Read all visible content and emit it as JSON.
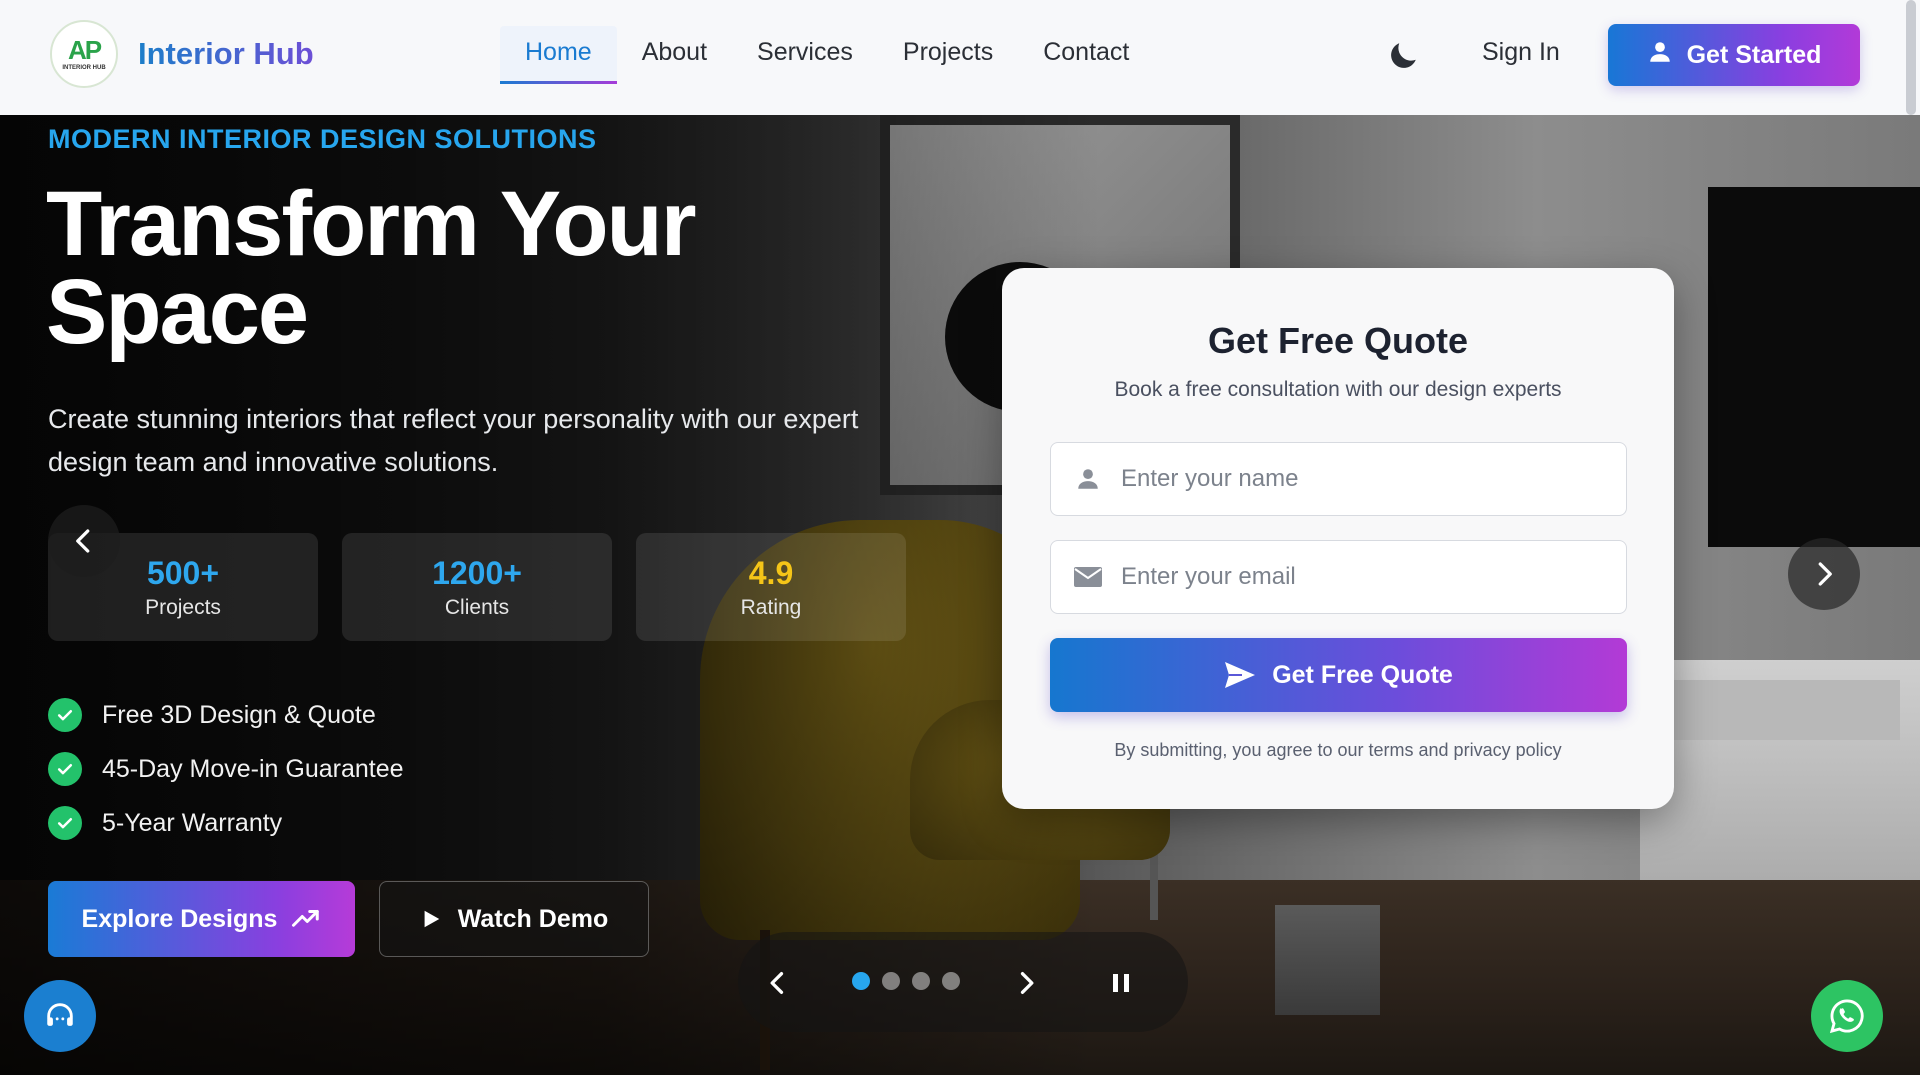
{
  "brand": {
    "name": "Interior Hub",
    "logo_text": "AP",
    "logo_caption": "INTERIOR HUB"
  },
  "nav": {
    "items": [
      {
        "label": "Home",
        "active": true
      },
      {
        "label": "About",
        "active": false
      },
      {
        "label": "Services",
        "active": false
      },
      {
        "label": "Projects",
        "active": false
      },
      {
        "label": "Contact",
        "active": false
      }
    ],
    "theme_icon": "moon-icon",
    "sign_in": "Sign In",
    "get_started": "Get Started"
  },
  "hero": {
    "eyebrow": "MODERN INTERIOR DESIGN SOLUTIONS",
    "headline_line1": "Transform Your",
    "headline_line2": "Space",
    "subtext": "Create stunning interiors that reflect your personality with our expert design team and innovative solutions.",
    "stats": [
      {
        "value": "500+",
        "label": "Projects",
        "color": "#2ea7ee"
      },
      {
        "value": "1200+",
        "label": "Clients",
        "color": "#2ea7ee"
      },
      {
        "value": "4.9",
        "label": "Rating",
        "color": "#f5c518"
      }
    ],
    "features": [
      "Free 3D Design & Quote",
      "45-Day Move-in Guarantee",
      "5-Year Warranty"
    ],
    "explore_label": "Explore Designs",
    "demo_label": "Watch Demo"
  },
  "quote_form": {
    "title": "Get Free Quote",
    "subtitle": "Book a free consultation with our design experts",
    "name_placeholder": "Enter your name",
    "email_placeholder": "Enter your email",
    "submit_label": "Get Free Quote",
    "terms": "By submitting, you agree to our terms and privacy policy"
  },
  "slider": {
    "slide_count": 4,
    "current_slide": 1
  },
  "colors": {
    "accent_blue": "#1a7bd1",
    "accent_purple": "#b23ad8",
    "success_green": "#23c26b",
    "whatsapp_green": "#2dc463",
    "rating_gold": "#f5c518"
  }
}
